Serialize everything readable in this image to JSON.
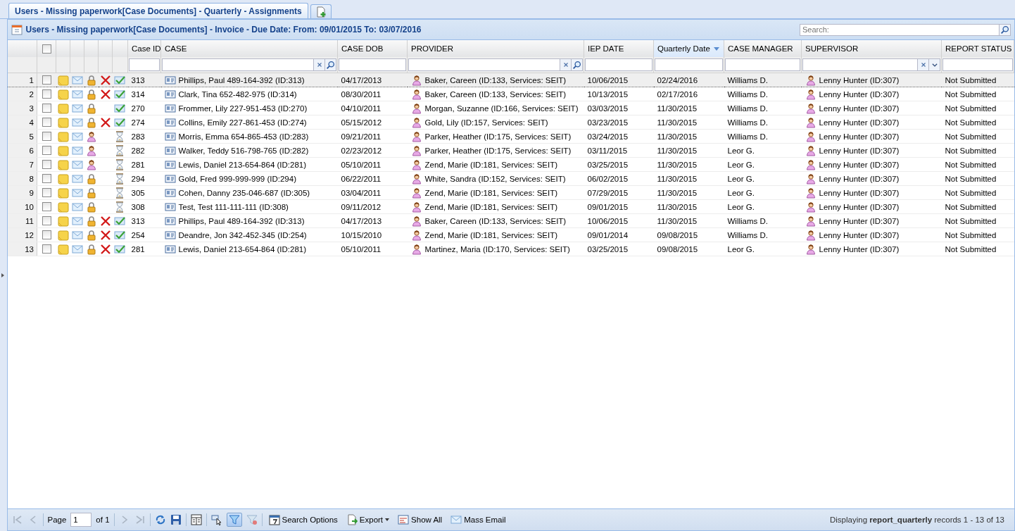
{
  "tabs": [
    {
      "label": "Users - Missing paperwork[Case Documents] - Quarterly - Assignments",
      "selected": true
    }
  ],
  "panel": {
    "title": "Users - Missing paperwork[Case Documents] - Invoice - Due Date: From: 09/01/2015 To: 03/07/2016"
  },
  "search": {
    "placeholder": "Search:"
  },
  "columns": [
    {
      "label": "Case ID",
      "sorted": false
    },
    {
      "label": "CASE",
      "sorted": false
    },
    {
      "label": "CASE DOB",
      "sorted": false
    },
    {
      "label": "PROVIDER",
      "sorted": false
    },
    {
      "label": "IEP DATE",
      "sorted": false
    },
    {
      "label": "Quarterly Date",
      "sorted": true
    },
    {
      "label": "CASE MANAGER",
      "sorted": false
    },
    {
      "label": "SUPERVISOR",
      "sorted": false
    },
    {
      "label": "REPORT STATUS",
      "sorted": false
    }
  ],
  "header_checkbox": {
    "checked": false
  },
  "rows": [
    {
      "num": "1",
      "checked": false,
      "selected": true,
      "locked": true,
      "rejected": true,
      "pending": false,
      "cells": [
        "313",
        "Phillips, Paul 489-164-392 (ID:313)",
        "04/17/2013",
        "Baker, Careen (ID:133, Services: SEIT)",
        "10/06/2015",
        "02/24/2016",
        "Williams D.",
        "Lenny Hunter (ID:307)",
        "Not Submitted"
      ]
    },
    {
      "num": "2",
      "checked": false,
      "selected": false,
      "locked": true,
      "rejected": true,
      "pending": false,
      "cells": [
        "314",
        "Clark, Tina 652-482-975 (ID:314)",
        "08/30/2011",
        "Baker, Careen (ID:133, Services: SEIT)",
        "10/13/2015",
        "02/17/2016",
        "Williams D.",
        "Lenny Hunter (ID:307)",
        "Not Submitted"
      ]
    },
    {
      "num": "3",
      "checked": false,
      "selected": false,
      "locked": true,
      "rejected": false,
      "pending": false,
      "cells": [
        "270",
        "Frommer, Lily 227-951-453 (ID:270)",
        "04/10/2011",
        "Morgan, Suzanne (ID:166, Services: SEIT)",
        "03/03/2015",
        "11/30/2015",
        "Williams D.",
        "Lenny Hunter (ID:307)",
        "Not Submitted"
      ]
    },
    {
      "num": "4",
      "checked": false,
      "selected": false,
      "locked": true,
      "rejected": true,
      "pending": false,
      "cells": [
        "274",
        "Collins, Emily 227-861-453 (ID:274)",
        "05/15/2012",
        "Gold, Lily (ID:157, Services: SEIT)",
        "03/23/2015",
        "11/30/2015",
        "Williams D.",
        "Lenny Hunter (ID:307)",
        "Not Submitted"
      ]
    },
    {
      "num": "5",
      "checked": false,
      "selected": false,
      "locked": false,
      "rejected": false,
      "pending": true,
      "cells": [
        "283",
        "Morris, Emma 654-865-453 (ID:283)",
        "09/21/2011",
        "Parker, Heather (ID:175, Services: SEIT)",
        "03/24/2015",
        "11/30/2015",
        "Williams D.",
        "Lenny Hunter (ID:307)",
        "Not Submitted"
      ]
    },
    {
      "num": "6",
      "checked": false,
      "selected": false,
      "locked": false,
      "rejected": false,
      "pending": true,
      "cells": [
        "282",
        "Walker, Teddy 516-798-765 (ID:282)",
        "02/23/2012",
        "Parker, Heather (ID:175, Services: SEIT)",
        "03/11/2015",
        "11/30/2015",
        "Leor G.",
        "Lenny Hunter (ID:307)",
        "Not Submitted"
      ]
    },
    {
      "num": "7",
      "checked": false,
      "selected": false,
      "locked": false,
      "rejected": false,
      "pending": true,
      "cells": [
        "281",
        "Lewis, Daniel 213-654-864 (ID:281)",
        "05/10/2011",
        "Zend, Marie (ID:181, Services: SEIT)",
        "03/25/2015",
        "11/30/2015",
        "Leor G.",
        "Lenny Hunter (ID:307)",
        "Not Submitted"
      ]
    },
    {
      "num": "8",
      "checked": false,
      "selected": false,
      "locked": true,
      "rejected": false,
      "pending": true,
      "cells": [
        "294",
        "Gold, Fred 999-999-999 (ID:294)",
        "06/22/2011",
        "White, Sandra (ID:152, Services: SEIT)",
        "06/02/2015",
        "11/30/2015",
        "Leor G.",
        "Lenny Hunter (ID:307)",
        "Not Submitted"
      ]
    },
    {
      "num": "9",
      "checked": false,
      "selected": false,
      "locked": true,
      "rejected": false,
      "pending": true,
      "cells": [
        "305",
        "Cohen, Danny 235-046-687 (ID:305)",
        "03/04/2011",
        "Zend, Marie (ID:181, Services: SEIT)",
        "07/29/2015",
        "11/30/2015",
        "Leor G.",
        "Lenny Hunter (ID:307)",
        "Not Submitted"
      ]
    },
    {
      "num": "10",
      "checked": false,
      "selected": false,
      "locked": true,
      "rejected": false,
      "pending": true,
      "cells": [
        "308",
        "Test, Test 111-111-111 (ID:308)",
        "09/11/2012",
        "Zend, Marie (ID:181, Services: SEIT)",
        "09/01/2015",
        "11/30/2015",
        "Leor G.",
        "Lenny Hunter (ID:307)",
        "Not Submitted"
      ]
    },
    {
      "num": "11",
      "checked": false,
      "selected": false,
      "locked": true,
      "rejected": true,
      "pending": false,
      "cells": [
        "313",
        "Phillips, Paul 489-164-392 (ID:313)",
        "04/17/2013",
        "Baker, Careen (ID:133, Services: SEIT)",
        "10/06/2015",
        "11/30/2015",
        "Williams D.",
        "Lenny Hunter (ID:307)",
        "Not Submitted"
      ]
    },
    {
      "num": "12",
      "checked": false,
      "selected": false,
      "locked": true,
      "rejected": true,
      "pending": false,
      "cells": [
        "254",
        "Deandre, Jon 342-452-345 (ID:254)",
        "10/15/2010",
        "Zend, Marie (ID:181, Services: SEIT)",
        "09/01/2014",
        "09/08/2015",
        "Williams D.",
        "Lenny Hunter (ID:307)",
        "Not Submitted"
      ]
    },
    {
      "num": "13",
      "checked": false,
      "selected": false,
      "locked": true,
      "rejected": true,
      "pending": false,
      "cells": [
        "281",
        "Lewis, Daniel 213-654-864 (ID:281)",
        "05/10/2011",
        "Martinez, Maria (ID:170, Services: SEIT)",
        "03/25/2015",
        "09/08/2015",
        "Leor G.",
        "Lenny Hunter (ID:307)",
        "Not Submitted"
      ]
    }
  ],
  "pager": {
    "page_label": "Page",
    "page_value": "1",
    "of_label": "of 1",
    "filter_active": true
  },
  "toolbar_buttons": [
    {
      "label": "Search Options",
      "kind": "calendar"
    },
    {
      "label": "Export",
      "kind": "export"
    },
    {
      "label": "Show All",
      "kind": "list"
    },
    {
      "label": "Mass Email",
      "kind": "mail"
    }
  ],
  "status": "Displaying **report_quarterly** records 1 - 13 of 13"
}
